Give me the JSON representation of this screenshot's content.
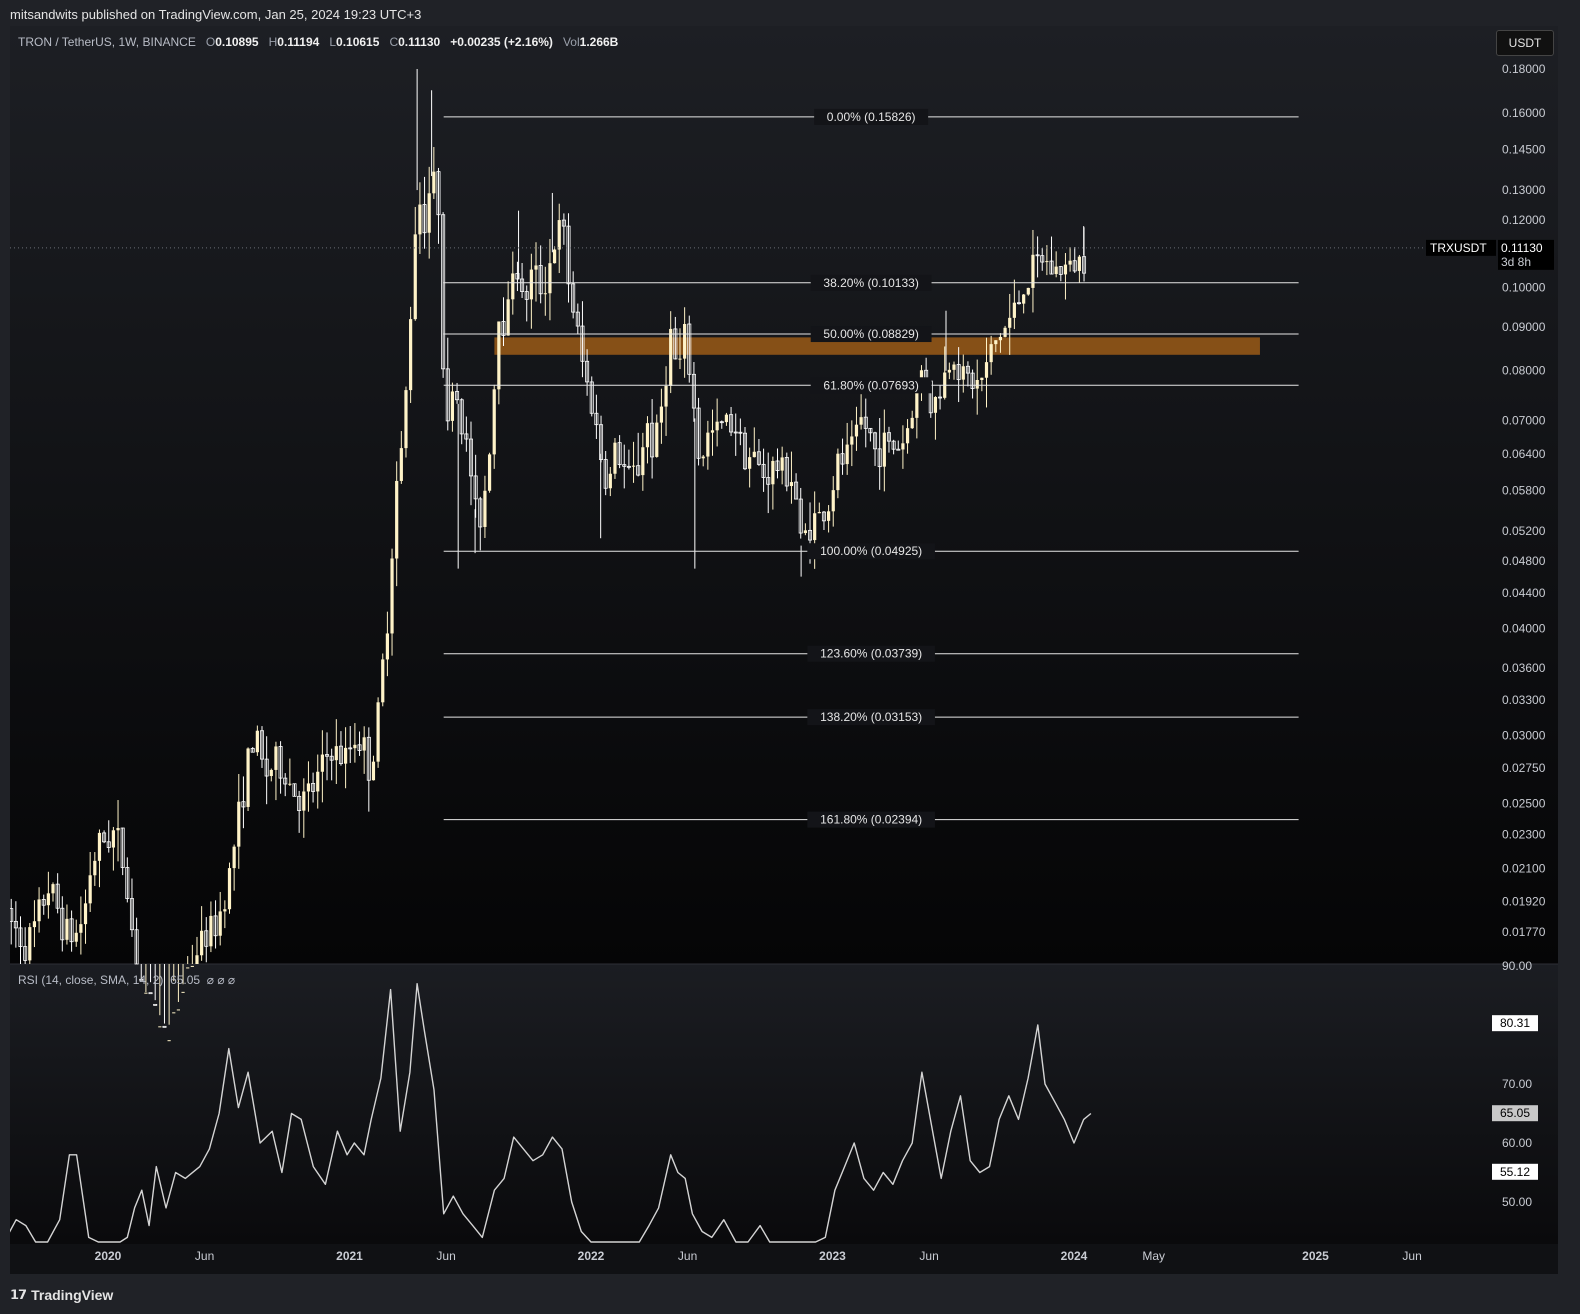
{
  "header": {
    "text": "mitsandwits published on TradingView.com, Jan 25, 2024 19:23 UTC+3"
  },
  "legend": {
    "symbol": "TRON / TetherUS, 1W, BINANCE",
    "o_label": "O",
    "o": "0.10895",
    "h_label": "H",
    "h": "0.11194",
    "l_label": "L",
    "l": "0.10615",
    "c_label": "C",
    "c": "0.11130",
    "change": "+0.00235 (+2.16%)",
    "vol_label": "Vol",
    "vol": "1.266B"
  },
  "currency_button": "USDT",
  "price_tag": {
    "symbol": "TRXUSDT",
    "price": "0.11130",
    "countdown": "3d 8h"
  },
  "rsi_legend": {
    "text": "RSI (14, close, SMA, 14, 2)",
    "value": "65.05",
    "extra": "⌀ ⌀ ⌀"
  },
  "footer": {
    "logo_icon": "tradingview-logo-icon",
    "text": "TradingView"
  },
  "colors": {
    "background": "#101114",
    "candle_up": "#fff3c8",
    "candle_down": "#ffffff",
    "fib_line": "#e6e6e6",
    "zone": "#9a5a17",
    "rsi_line": "#d4d4d4"
  },
  "chart_data": [
    {
      "type": "candlestick",
      "title": "TRON / TetherUS, 1W, BINANCE",
      "scale": "log",
      "y_ticks": [
        "0.18000",
        "0.16000",
        "0.14500",
        "0.13000",
        "0.12000",
        "0.10000",
        "0.09000",
        "0.08000",
        "0.07000",
        "0.06400",
        "0.05800",
        "0.05200",
        "0.04800",
        "0.04400",
        "0.04000",
        "0.03600",
        "0.03300",
        "0.03000",
        "0.02750",
        "0.02500",
        "0.02300",
        "0.02100",
        "0.01920",
        "0.01770"
      ],
      "x_ticks": [
        {
          "label": "2020",
          "bold": true,
          "t": 2020.0
        },
        {
          "label": "Jun",
          "bold": false,
          "t": 2020.4
        },
        {
          "label": "2021",
          "bold": true,
          "t": 2021.0
        },
        {
          "label": "Jun",
          "bold": false,
          "t": 2021.4
        },
        {
          "label": "2022",
          "bold": true,
          "t": 2022.0
        },
        {
          "label": "Jun",
          "bold": false,
          "t": 2022.4
        },
        {
          "label": "2023",
          "bold": true,
          "t": 2023.0
        },
        {
          "label": "Jun",
          "bold": false,
          "t": 2023.4
        },
        {
          "label": "2024",
          "bold": true,
          "t": 2024.0
        },
        {
          "label": "May",
          "bold": false,
          "t": 2024.33
        },
        {
          "label": "2025",
          "bold": true,
          "t": 2025.0
        },
        {
          "label": "Jun",
          "bold": false,
          "t": 2025.4
        }
      ],
      "fib_levels": [
        {
          "label": "0.00% (0.15826)",
          "price": 0.15826
        },
        {
          "label": "38.20% (0.10133)",
          "price": 0.10133
        },
        {
          "label": "50.00% (0.08829)",
          "price": 0.08829
        },
        {
          "label": "61.80% (0.07693)",
          "price": 0.07693
        },
        {
          "label": "100.00% (0.04925)",
          "price": 0.04925
        },
        {
          "label": "123.60% (0.03739)",
          "price": 0.03739
        },
        {
          "label": "138.20% (0.03153)",
          "price": 0.03153
        },
        {
          "label": "161.80% (0.02394)",
          "price": 0.02394
        }
      ],
      "fib_range": {
        "from": 2021.39,
        "to": 2024.93
      },
      "zone": {
        "from": 2021.6,
        "to": 2024.77,
        "top": 0.0875,
        "bottom": 0.0835
      },
      "last_price": 0.1113,
      "path": [
        [
          2019.58,
          0.0185
        ],
        [
          2019.62,
          0.0178
        ],
        [
          2019.66,
          0.017
        ],
        [
          2019.7,
          0.018
        ],
        [
          2019.75,
          0.02
        ],
        [
          2019.78,
          0.0193
        ],
        [
          2019.82,
          0.0178
        ],
        [
          2019.86,
          0.0174
        ],
        [
          2019.9,
          0.0185
        ],
        [
          2019.93,
          0.0212
        ],
        [
          2019.97,
          0.0225
        ],
        [
          2020.03,
          0.0232
        ],
        [
          2020.07,
          0.021
        ],
        [
          2020.13,
          0.015
        ],
        [
          2020.25,
          0.013
        ],
        [
          2020.33,
          0.016
        ],
        [
          2020.4,
          0.0175
        ],
        [
          2020.45,
          0.018
        ],
        [
          2020.5,
          0.0205
        ],
        [
          2020.55,
          0.025
        ],
        [
          2020.58,
          0.028
        ],
        [
          2020.61,
          0.03
        ],
        [
          2020.65,
          0.027
        ],
        [
          2020.7,
          0.028
        ],
        [
          2020.75,
          0.0265
        ],
        [
          2020.8,
          0.025
        ],
        [
          2020.85,
          0.026
        ],
        [
          2020.92,
          0.029
        ],
        [
          2020.98,
          0.028
        ],
        [
          2021.02,
          0.03
        ],
        [
          2021.06,
          0.029
        ],
        [
          2021.09,
          0.027
        ],
        [
          2021.12,
          0.032
        ],
        [
          2021.16,
          0.042
        ],
        [
          2021.19,
          0.058
        ],
        [
          2021.22,
          0.065
        ],
        [
          2021.25,
          0.09
        ],
        [
          2021.28,
          0.13
        ],
        [
          2021.31,
          0.12
        ],
        [
          2021.34,
          0.135
        ],
        [
          2021.37,
          0.125
        ],
        [
          2021.4,
          0.064
        ],
        [
          2021.43,
          0.08
        ],
        [
          2021.46,
          0.07
        ],
        [
          2021.5,
          0.062
        ],
        [
          2021.53,
          0.052
        ],
        [
          2021.56,
          0.058
        ],
        [
          2021.59,
          0.07
        ],
        [
          2021.62,
          0.095
        ],
        [
          2021.65,
          0.09
        ],
        [
          2021.68,
          0.11
        ],
        [
          2021.72,
          0.095
        ],
        [
          2021.76,
          0.105
        ],
        [
          2021.8,
          0.099
        ],
        [
          2021.84,
          0.11
        ],
        [
          2021.88,
          0.12
        ],
        [
          2021.91,
          0.1
        ],
        [
          2021.94,
          0.09
        ],
        [
          2021.97,
          0.08
        ],
        [
          2022.01,
          0.072
        ],
        [
          2022.04,
          0.064
        ],
        [
          2022.07,
          0.058
        ],
        [
          2022.1,
          0.065
        ],
        [
          2022.13,
          0.062
        ],
        [
          2022.16,
          0.06
        ],
        [
          2022.2,
          0.062
        ],
        [
          2022.23,
          0.07
        ],
        [
          2022.26,
          0.064
        ],
        [
          2022.29,
          0.072
        ],
        [
          2022.33,
          0.088
        ],
        [
          2022.36,
          0.079
        ],
        [
          2022.39,
          0.088
        ],
        [
          2022.42,
          0.075
        ],
        [
          2022.45,
          0.062
        ],
        [
          2022.48,
          0.067
        ],
        [
          2022.52,
          0.068
        ],
        [
          2022.56,
          0.07
        ],
        [
          2022.6,
          0.069
        ],
        [
          2022.64,
          0.064
        ],
        [
          2022.68,
          0.063
        ],
        [
          2022.72,
          0.06
        ],
        [
          2022.76,
          0.062
        ],
        [
          2022.8,
          0.061
        ],
        [
          2022.84,
          0.06
        ],
        [
          2022.87,
          0.05
        ],
        [
          2022.9,
          0.053
        ],
        [
          2022.94,
          0.054
        ],
        [
          2022.98,
          0.055
        ],
        [
          2023.02,
          0.062
        ],
        [
          2023.05,
          0.063
        ],
        [
          2023.08,
          0.065
        ],
        [
          2023.12,
          0.07
        ],
        [
          2023.15,
          0.068
        ],
        [
          2023.18,
          0.064
        ],
        [
          2023.21,
          0.066
        ],
        [
          2023.25,
          0.065
        ],
        [
          2023.29,
          0.066
        ],
        [
          2023.32,
          0.07
        ],
        [
          2023.35,
          0.076
        ],
        [
          2023.38,
          0.082
        ],
        [
          2023.41,
          0.072
        ],
        [
          2023.44,
          0.075
        ],
        [
          2023.47,
          0.08
        ],
        [
          2023.5,
          0.084
        ],
        [
          2023.53,
          0.08
        ],
        [
          2023.56,
          0.078
        ],
        [
          2023.6,
          0.077
        ],
        [
          2023.63,
          0.079
        ],
        [
          2023.66,
          0.085
        ],
        [
          2023.69,
          0.088
        ],
        [
          2023.72,
          0.09
        ],
        [
          2023.76,
          0.095
        ],
        [
          2023.79,
          0.1
        ],
        [
          2023.83,
          0.105
        ],
        [
          2023.87,
          0.108
        ],
        [
          2023.91,
          0.105
        ],
        [
          2023.95,
          0.105
        ],
        [
          2023.99,
          0.106
        ],
        [
          2024.03,
          0.108
        ],
        [
          2024.06,
          0.1113
        ]
      ],
      "spikes": [
        [
          2021.28,
          0.18
        ],
        [
          2021.34,
          0.17
        ],
        [
          2021.45,
          0.047
        ],
        [
          2021.52,
          0.049
        ],
        [
          2021.84,
          0.129
        ],
        [
          2021.7,
          0.123
        ],
        [
          2022.04,
          0.051
        ],
        [
          2022.43,
          0.047
        ],
        [
          2022.87,
          0.046
        ],
        [
          2023.47,
          0.094
        ],
        [
          2024.04,
          0.118
        ]
      ]
    },
    {
      "type": "line",
      "title": "RSI (14, close, SMA, 14, 2)",
      "y_ticks": [
        "90.00",
        "70.00",
        "60.00",
        "50.00"
      ],
      "value_tags": [
        "80.31",
        "65.05",
        "55.12"
      ],
      "points": [
        [
          2019.58,
          44
        ],
        [
          2019.62,
          47
        ],
        [
          2019.66,
          46
        ],
        [
          2019.7,
          41
        ],
        [
          2019.75,
          40
        ],
        [
          2019.8,
          47
        ],
        [
          2019.84,
          58
        ],
        [
          2019.87,
          58
        ],
        [
          2019.92,
          44
        ],
        [
          2019.96,
          40
        ],
        [
          2020.0,
          38
        ],
        [
          2020.05,
          42
        ],
        [
          2020.08,
          44
        ],
        [
          2020.11,
          49
        ],
        [
          2020.14,
          52
        ],
        [
          2020.17,
          46
        ],
        [
          2020.2,
          56
        ],
        [
          2020.24,
          49
        ],
        [
          2020.28,
          55
        ],
        [
          2020.32,
          54
        ],
        [
          2020.38,
          56
        ],
        [
          2020.42,
          59
        ],
        [
          2020.46,
          65
        ],
        [
          2020.5,
          76
        ],
        [
          2020.54,
          66
        ],
        [
          2020.58,
          72
        ],
        [
          2020.63,
          60
        ],
        [
          2020.68,
          62
        ],
        [
          2020.72,
          55
        ],
        [
          2020.76,
          65
        ],
        [
          2020.8,
          64
        ],
        [
          2020.85,
          56
        ],
        [
          2020.9,
          53
        ],
        [
          2020.95,
          62
        ],
        [
          2020.99,
          58
        ],
        [
          2021.02,
          60
        ],
        [
          2021.06,
          58
        ],
        [
          2021.09,
          64
        ],
        [
          2021.13,
          71
        ],
        [
          2021.17,
          86
        ],
        [
          2021.21,
          62
        ],
        [
          2021.25,
          72
        ],
        [
          2021.28,
          87
        ],
        [
          2021.31,
          79
        ],
        [
          2021.35,
          69
        ],
        [
          2021.39,
          48
        ],
        [
          2021.43,
          51
        ],
        [
          2021.47,
          48
        ],
        [
          2021.51,
          46
        ],
        [
          2021.55,
          44
        ],
        [
          2021.6,
          52
        ],
        [
          2021.64,
          54
        ],
        [
          2021.68,
          61
        ],
        [
          2021.72,
          59
        ],
        [
          2021.76,
          57
        ],
        [
          2021.8,
          58
        ],
        [
          2021.84,
          61
        ],
        [
          2021.88,
          59
        ],
        [
          2021.92,
          50
        ],
        [
          2021.96,
          45
        ],
        [
          2022.0,
          38
        ],
        [
          2022.05,
          36
        ],
        [
          2022.1,
          39
        ],
        [
          2022.15,
          34
        ],
        [
          2022.2,
          38
        ],
        [
          2022.24,
          46
        ],
        [
          2022.28,
          49
        ],
        [
          2022.33,
          58
        ],
        [
          2022.36,
          55
        ],
        [
          2022.39,
          54
        ],
        [
          2022.42,
          48
        ],
        [
          2022.46,
          45
        ],
        [
          2022.5,
          44
        ],
        [
          2022.55,
          47
        ],
        [
          2022.6,
          42
        ],
        [
          2022.65,
          36
        ],
        [
          2022.7,
          46
        ],
        [
          2022.74,
          40
        ],
        [
          2022.78,
          38
        ],
        [
          2022.82,
          40
        ],
        [
          2022.86,
          36
        ],
        [
          2022.89,
          33
        ],
        [
          2022.93,
          37
        ],
        [
          2022.97,
          44
        ],
        [
          2023.01,
          52
        ],
        [
          2023.05,
          56
        ],
        [
          2023.09,
          60
        ],
        [
          2023.13,
          54
        ],
        [
          2023.17,
          52
        ],
        [
          2023.21,
          55
        ],
        [
          2023.25,
          53
        ],
        [
          2023.29,
          57
        ],
        [
          2023.33,
          60
        ],
        [
          2023.37,
          72
        ],
        [
          2023.41,
          63
        ],
        [
          2023.45,
          54
        ],
        [
          2023.49,
          62
        ],
        [
          2023.53,
          68
        ],
        [
          2023.57,
          57
        ],
        [
          2023.61,
          55
        ],
        [
          2023.65,
          56
        ],
        [
          2023.69,
          64
        ],
        [
          2023.73,
          68
        ],
        [
          2023.77,
          64
        ],
        [
          2023.81,
          71
        ],
        [
          2023.85,
          80
        ],
        [
          2023.88,
          70
        ],
        [
          2023.92,
          67
        ],
        [
          2023.96,
          64
        ],
        [
          2024.0,
          60
        ],
        [
          2024.04,
          64
        ],
        [
          2024.07,
          65
        ]
      ]
    }
  ]
}
